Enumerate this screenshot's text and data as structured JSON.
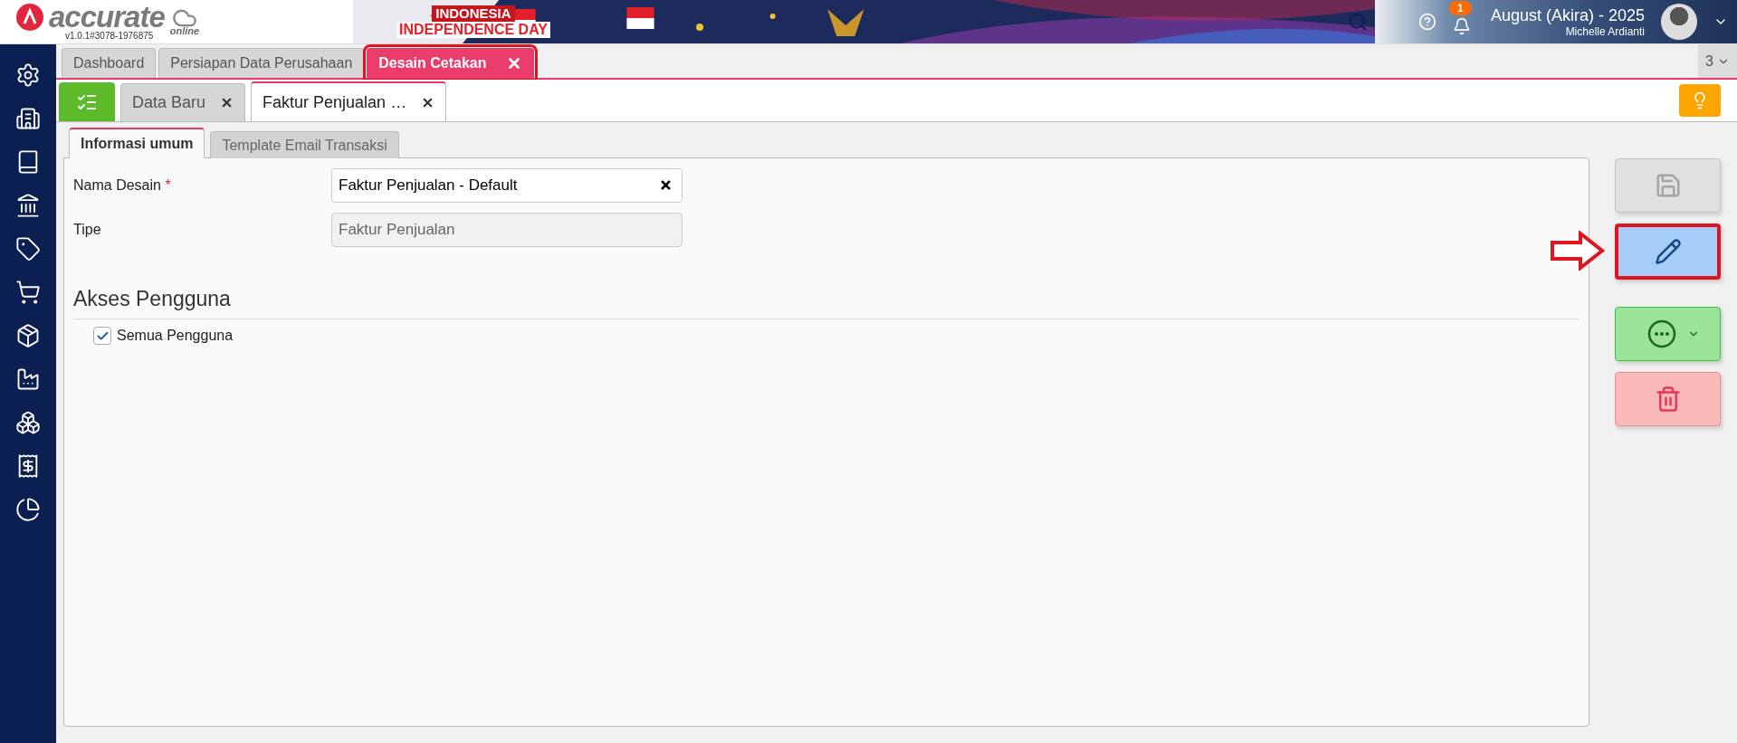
{
  "header": {
    "logo": "accurate",
    "logo_sub": "online",
    "version": "v1.0.1#3078-1976875",
    "banner_lines": [
      "INDONESIA",
      "INDEPENDENCE DAY"
    ],
    "notifications": "1",
    "period": "August (Akira) - 2025",
    "user": "Michelle Ardianti"
  },
  "sidebar": {
    "items": [
      {
        "kind": "settings"
      },
      {
        "kind": "company"
      },
      {
        "kind": "ledger"
      },
      {
        "kind": "bank"
      },
      {
        "kind": "sales-tag"
      },
      {
        "kind": "purchase"
      },
      {
        "kind": "inventory"
      },
      {
        "kind": "assets"
      },
      {
        "kind": "production"
      },
      {
        "kind": "tax"
      },
      {
        "kind": "reports"
      }
    ]
  },
  "module_tabs": [
    {
      "label": "Dashboard",
      "selected": false,
      "closable": false,
      "annotated": false
    },
    {
      "label": "Persiapan Data Perusahaan",
      "selected": false,
      "closable": false,
      "annotated": false
    },
    {
      "label": "Desain Cetakan",
      "selected": true,
      "closable": true,
      "annotated": true
    }
  ],
  "tab_count": "3",
  "doc_tabs": [
    {
      "label": "Data Baru",
      "selected": false
    },
    {
      "label": "Faktur Penjualan …",
      "selected": true
    }
  ],
  "form_tabs": [
    {
      "label": "Informasi umum",
      "selected": true
    },
    {
      "label": "Template Email Transaksi",
      "selected": false
    }
  ],
  "fields": [
    {
      "label": "Nama Desain",
      "mark": "*",
      "value": "Faktur Penjualan - Default",
      "disabled": false,
      "clearable": true
    },
    {
      "label": "Tipe",
      "value": "Faktur Penjualan",
      "disabled": true,
      "clearable": false
    }
  ],
  "access": {
    "title": "Akses Pengguna",
    "options": [
      {
        "label": "Semua Pengguna",
        "checked": true
      }
    ]
  },
  "actions": [
    {
      "kind": "save",
      "disabled": true,
      "annotated": false
    },
    {
      "kind": "edit",
      "disabled": false,
      "annotated": true
    },
    {
      "kind": "more",
      "disabled": false,
      "annotated": false
    },
    {
      "kind": "delete",
      "disabled": false,
      "annotated": false
    }
  ]
}
